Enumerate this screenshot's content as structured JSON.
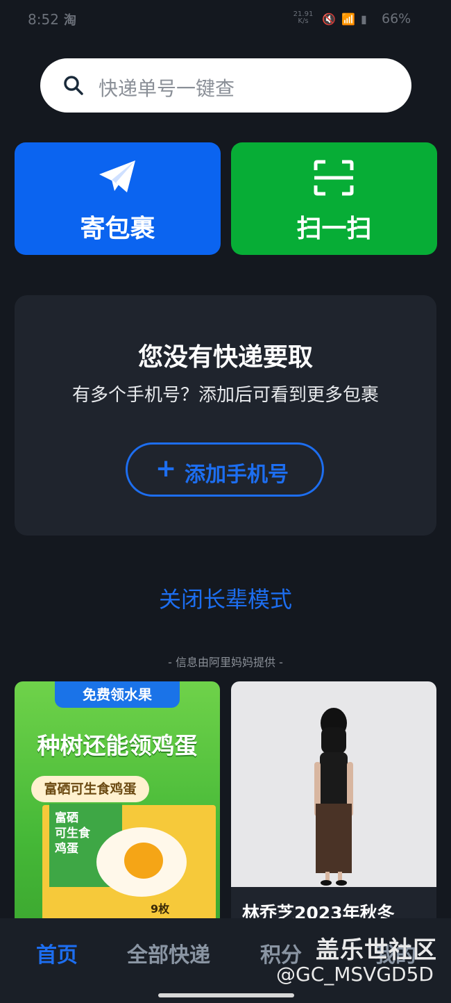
{
  "status_bar": {
    "time": "8:52",
    "app_glyph": "淘",
    "net_speed": "21.91",
    "net_unit": "K/s",
    "battery": "66%"
  },
  "search": {
    "placeholder": "快递单号一键查",
    "icon": "search-icon"
  },
  "actions": {
    "send_label": "寄包裹",
    "scan_label": "扫一扫",
    "send_color": "#0b64f0",
    "scan_color": "#07ad36"
  },
  "empty_state": {
    "title": "您没有快递要取",
    "subtitle": "有多个手机号？添加后可看到更多包裹",
    "add_phone_plus": "+",
    "add_phone_label": "添加手机号"
  },
  "elder_mode_link": "关闭长辈模式",
  "provider_note": "- 信息由阿里妈妈提供 -",
  "ads": [
    {
      "tag": "免费领水果",
      "headline": "种树还能领鸡蛋",
      "pill": "富硒可生食鸡蛋",
      "box_lines": [
        "富硒",
        "可生食",
        "鸡蛋"
      ],
      "box_count": "9枚"
    },
    {
      "caption": "林乔芝2023年秋冬"
    }
  ],
  "nav": {
    "items": [
      "首页",
      "全部快递",
      "积分",
      "我的"
    ],
    "active": "首页",
    "accent": "#1d6ef0"
  },
  "watermark": {
    "line1": "盖乐世社区",
    "line2": "@GC_MSVGD5D"
  }
}
